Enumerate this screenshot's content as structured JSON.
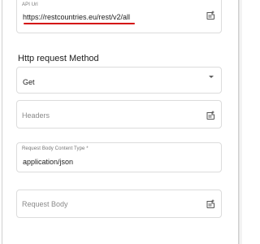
{
  "api_url": {
    "label": "API Url",
    "value": "https://restcountries.eu/rest/v2/all"
  },
  "http_method": {
    "heading": "Http request Method",
    "selected": "Get"
  },
  "headers": {
    "placeholder": "Headers"
  },
  "content_type": {
    "label": "Request Body Content Type *",
    "value": "application/json"
  },
  "request_body": {
    "placeholder": "Request Body"
  },
  "icons": {
    "edit_field": "note-add-icon",
    "dropdown": "arrow-drop-down-icon"
  },
  "colors": {
    "annotation_underline": "#d40d0d",
    "border": "#dcdcdc"
  }
}
